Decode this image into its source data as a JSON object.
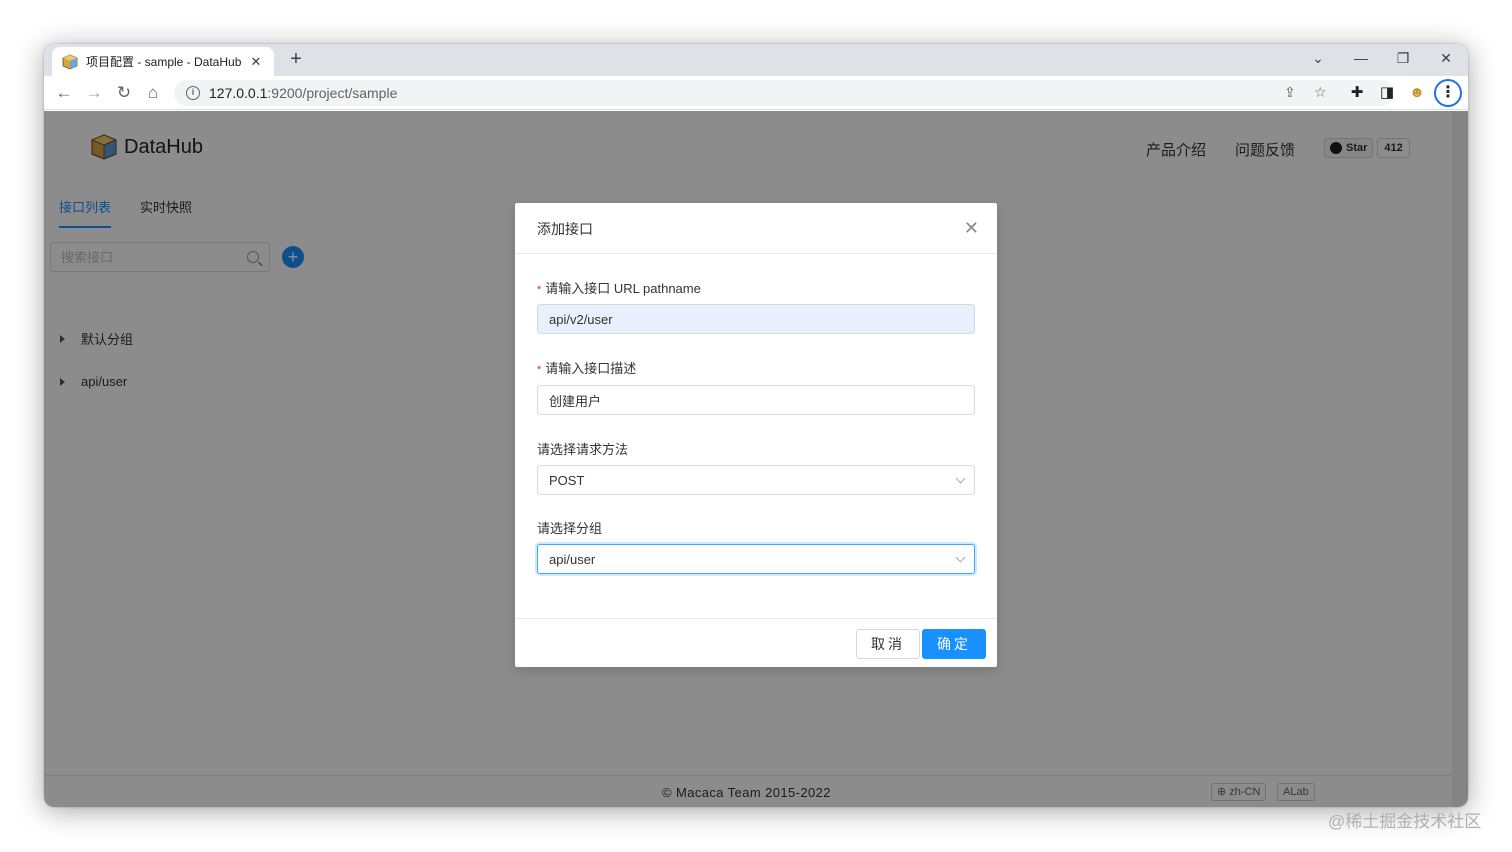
{
  "browser": {
    "tab_title": "项目配置 - sample - DataHub",
    "tab_close": "✕",
    "new_tab": "+",
    "url_host": "127.0.0.1",
    "url_path": ":9200/project/sample",
    "window_controls": {
      "dropdown": "⌄",
      "minimize": "—",
      "restore": "❐",
      "close": "✕"
    }
  },
  "header": {
    "logo_text": "DataHub",
    "nav": [
      "产品介绍",
      "问题反馈"
    ],
    "github": {
      "star_label": "Star",
      "count": "412"
    }
  },
  "sidebar": {
    "tabs": [
      "接口列表",
      "实时快照"
    ],
    "search_placeholder": "搜索接口",
    "add_label": "+",
    "groups": [
      "默认分组",
      "api/user"
    ]
  },
  "modal": {
    "title": "添加接口",
    "close": "✕",
    "fields": {
      "pathname": {
        "label": "请输入接口 URL pathname",
        "required": "*",
        "value": "api/v2/user"
      },
      "desc": {
        "label": "请输入接口描述",
        "required": "*",
        "value": "创建用户"
      },
      "method": {
        "label": "请选择请求方法",
        "value": "POST"
      },
      "group": {
        "label": "请选择分组",
        "value": "api/user"
      }
    },
    "cancel_label": "取消",
    "ok_label": "确定"
  },
  "footer": {
    "copyright": "©  Macaca Team 2015-2022",
    "lang": "zh-CN",
    "lab": "ALab"
  },
  "watermark": "@稀土掘金技术社区",
  "colors": {
    "primary": "#1890ff",
    "required": "#f5222d"
  }
}
